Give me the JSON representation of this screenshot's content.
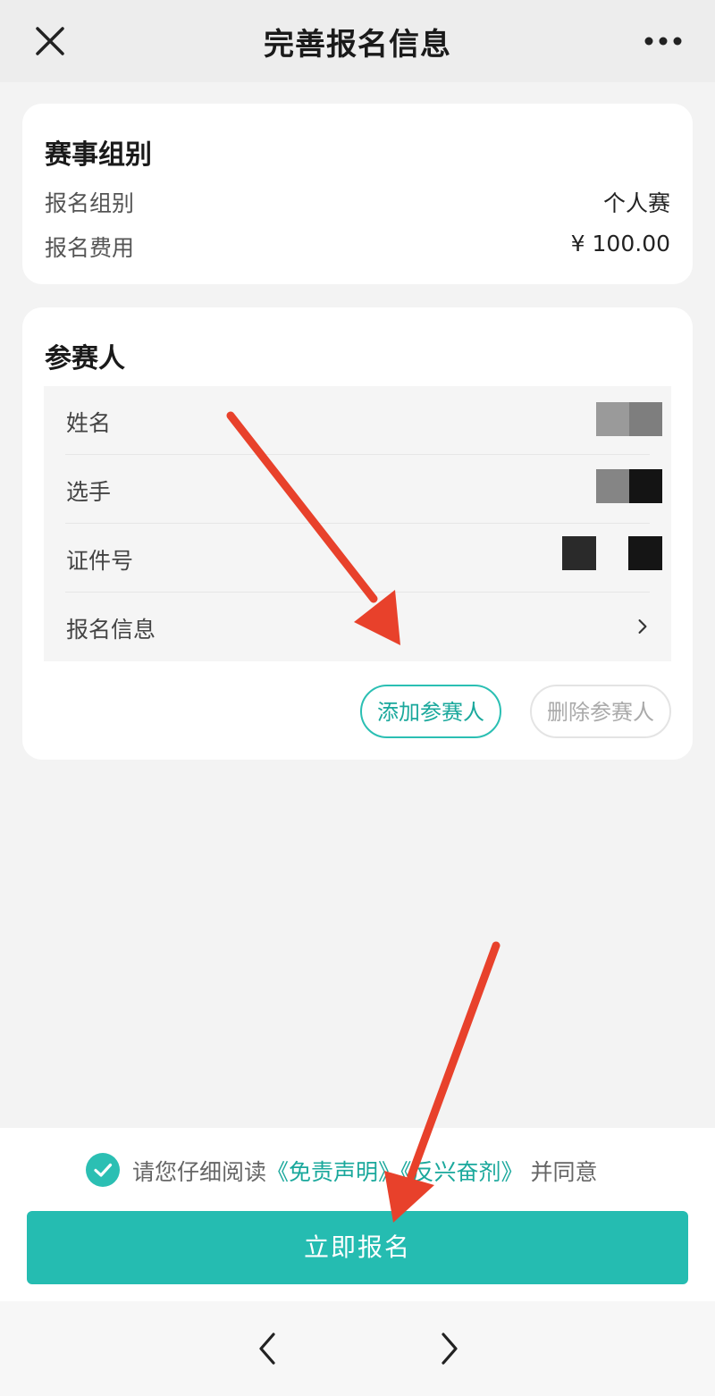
{
  "header": {
    "title": "完善报名信息",
    "close_icon": "close-icon",
    "more_icon": "more-dots-icon"
  },
  "event_group": {
    "title": "赛事组别",
    "group_label": "报名组别",
    "group_value": "个人赛",
    "fee_label": "报名费用",
    "fee_value": "¥ 100.00"
  },
  "participants": {
    "title": "参赛人",
    "rows": [
      {
        "label": "姓名"
      },
      {
        "label": "选手"
      },
      {
        "label": "证件号"
      },
      {
        "label": "报名信息"
      }
    ],
    "add_label": "添加参赛人",
    "delete_label": "删除参赛人"
  },
  "footer": {
    "agree_prefix": "请您仔细阅读",
    "disclaimer_link": "《免责声明》",
    "doping_link": "《反兴奋剂》",
    "agree_suffix": "并同意",
    "agree_checked": true,
    "submit_label": "立即报名"
  },
  "colors": {
    "accent": "#25bcb1",
    "annotation_arrow": "#e8412b"
  }
}
